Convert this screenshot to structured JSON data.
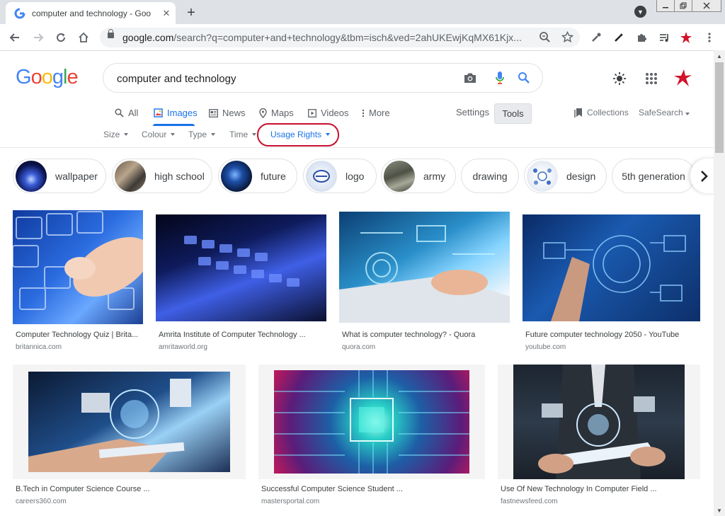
{
  "browser": {
    "tab_title": "computer and technology - Goo",
    "tab_close": "✕",
    "new_tab": "+",
    "url_host": "google.com",
    "url_path": "/search?q=computer+and+technology&tbm=isch&ved=2ahUKEwjKqMX61Kjx..."
  },
  "logo": [
    "G",
    "o",
    "o",
    "g",
    "l",
    "e"
  ],
  "search": {
    "query": "computer and technology"
  },
  "tabs": [
    {
      "label": "All"
    },
    {
      "label": "Images"
    },
    {
      "label": "News"
    },
    {
      "label": "Maps"
    },
    {
      "label": "Videos"
    },
    {
      "label": "More"
    }
  ],
  "settings_label": "Settings",
  "tools_label": "Tools",
  "collections_label": "Collections",
  "safesearch_label": "SafeSearch",
  "filters": [
    {
      "label": "Size"
    },
    {
      "label": "Colour"
    },
    {
      "label": "Type"
    },
    {
      "label": "Time"
    },
    {
      "label": "Usage Rights"
    }
  ],
  "chips": [
    {
      "label": "wallpaper"
    },
    {
      "label": "high school"
    },
    {
      "label": "future"
    },
    {
      "label": "logo"
    },
    {
      "label": "army"
    },
    {
      "label": "drawing"
    },
    {
      "label": "design"
    },
    {
      "label": "5th generation"
    }
  ],
  "results": [
    {
      "title": "Computer Technology Quiz | Brita...",
      "source": "britannica.com"
    },
    {
      "title": "Amrita Institute of Computer Technology ...",
      "source": "amritaworld.org"
    },
    {
      "title": "What is computer technology? - Quora",
      "source": "quora.com"
    },
    {
      "title": "Future computer technology 2050 - YouTube",
      "source": "youtube.com"
    },
    {
      "title": "B.Tech in Computer Science Course ...",
      "source": "careers360.com"
    },
    {
      "title": "Successful Computer Science Student ...",
      "source": "mastersportal.com"
    },
    {
      "title": "Use Of New Technology In Computer Field ...",
      "source": "fastnewsfeed.com"
    }
  ],
  "colors": {
    "accent": "#1a73e8",
    "annotation": "#c8102e"
  }
}
